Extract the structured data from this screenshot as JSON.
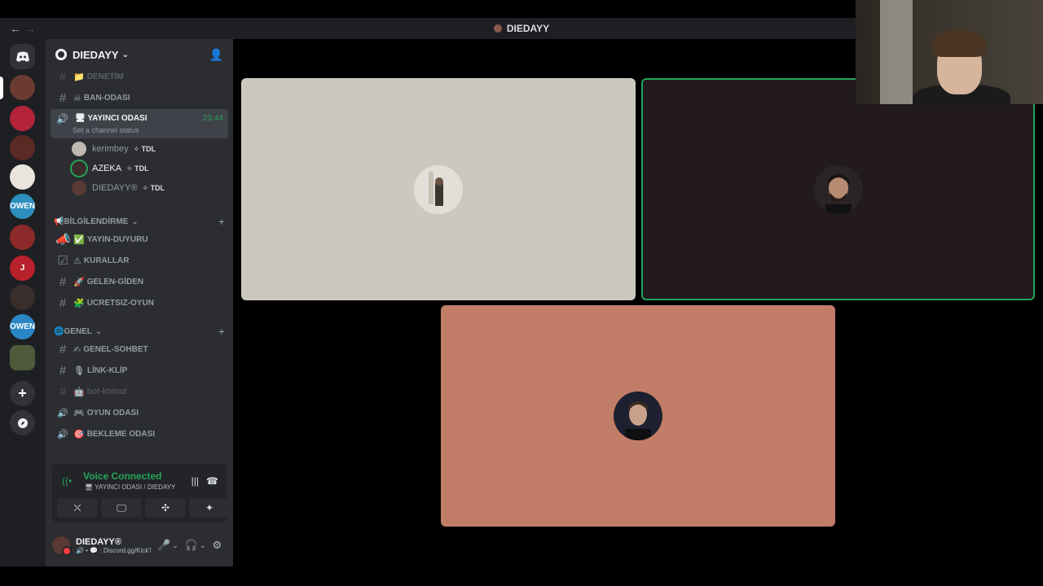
{
  "titlebar": {
    "back": "←",
    "forward": "→",
    "title": "DIEDAYY"
  },
  "rail": {
    "servers": [
      "home",
      "s1",
      "s2",
      "s3",
      "s4",
      "OWEN",
      "s6",
      "J",
      "s8",
      "OWEN",
      "s10"
    ],
    "add_icon": "+",
    "discover_icon": "compass"
  },
  "server": {
    "name": "DIEDAYY",
    "invite_icon": "add-person"
  },
  "channels": {
    "denetim": {
      "emoji": "📁",
      "label": "DENETİM"
    },
    "ban": {
      "emoji": "☠",
      "label": "BAN-ODASI"
    },
    "yayinci": {
      "emoji": "🖥",
      "label": "YAYINCI ODASI",
      "time": "23:44",
      "status": "Set a channel status"
    },
    "voice_users": [
      {
        "name": "kerimbey",
        "tag": "TDL"
      },
      {
        "name": "AZEKA",
        "tag": "TDL"
      },
      {
        "name": "DIEDAYY®",
        "tag": "TDL"
      }
    ],
    "cat_bilgi": "BİLGİLENDİRME",
    "yayin_duyuru": {
      "emoji": "✅",
      "label": "YAYIN-DUYURU"
    },
    "kurallar": {
      "emoji": "⚠",
      "label": "KURALLAR"
    },
    "gelen_giden": {
      "emoji": "🚀",
      "label": "GELEN-GİDEN"
    },
    "ucretsiz": {
      "emoji": "🧩",
      "label": "UCRETSIZ-OYUN"
    },
    "cat_genel": "GENEL",
    "genel_sohbet": {
      "emoji": "✍",
      "label": "GENEL-SOHBET"
    },
    "link_klip": {
      "emoji": "🎙",
      "label": "LİNK-KLİP"
    },
    "bot_komut": {
      "emoji": "🤖",
      "label": "bot-komut"
    },
    "oyun_odasi": {
      "emoji": "🎮",
      "label": "OYUN ODASI"
    },
    "bekleme": {
      "emoji": "🎯",
      "label": "BEKLEME ODASI"
    }
  },
  "voice_panel": {
    "label": "Voice Connected",
    "sub": "🖥 YAYINCI ODASI / DIEDAYY"
  },
  "user": {
    "name": "DIEDAYY®",
    "status": "🔊 • 💬 : Discord.gg/KickTi"
  },
  "icons": {
    "hash": "#",
    "speaker": "🔊",
    "plus": "+",
    "chevron": "⌄",
    "mic": "🎤",
    "headset": "🎧",
    "gear": "⚙",
    "camera_off": "⛌",
    "screen": "🖵",
    "activity": "✣",
    "soundboard": "✦",
    "wave": "|||",
    "hangup": "☎",
    "signal": "((•"
  },
  "colors": {
    "green": "#23a55a",
    "sidebar": "#2b2d31",
    "rail": "#1e1f22"
  }
}
